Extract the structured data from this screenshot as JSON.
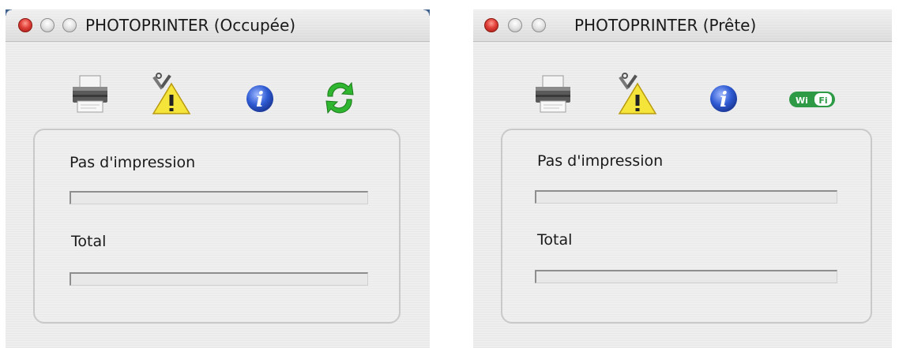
{
  "windows": [
    {
      "title": "PHOTOPRINTER (Occupée)",
      "toolbar_icons": [
        "printer-icon",
        "maintenance-warning-icon",
        "info-icon",
        "refresh-icon"
      ],
      "job_label": "Pas d'impression",
      "job_progress": 0,
      "total_label": "Total",
      "total_progress": 0
    },
    {
      "title": "PHOTOPRINTER (Prête)",
      "toolbar_icons": [
        "printer-icon",
        "maintenance-warning-icon",
        "info-icon",
        "wifi-icon"
      ],
      "job_label": "Pas d'impression",
      "job_progress": 0,
      "total_label": "Total",
      "total_progress": 0
    }
  ],
  "wifi_icon_text": "Wi Fi",
  "colors": {
    "close_button": "#e0403a",
    "info_icon": "#2f5bd3",
    "refresh_icon": "#2fb52f",
    "wifi_icon": "#2e9a46",
    "warning_icon": "#f5e43a"
  }
}
